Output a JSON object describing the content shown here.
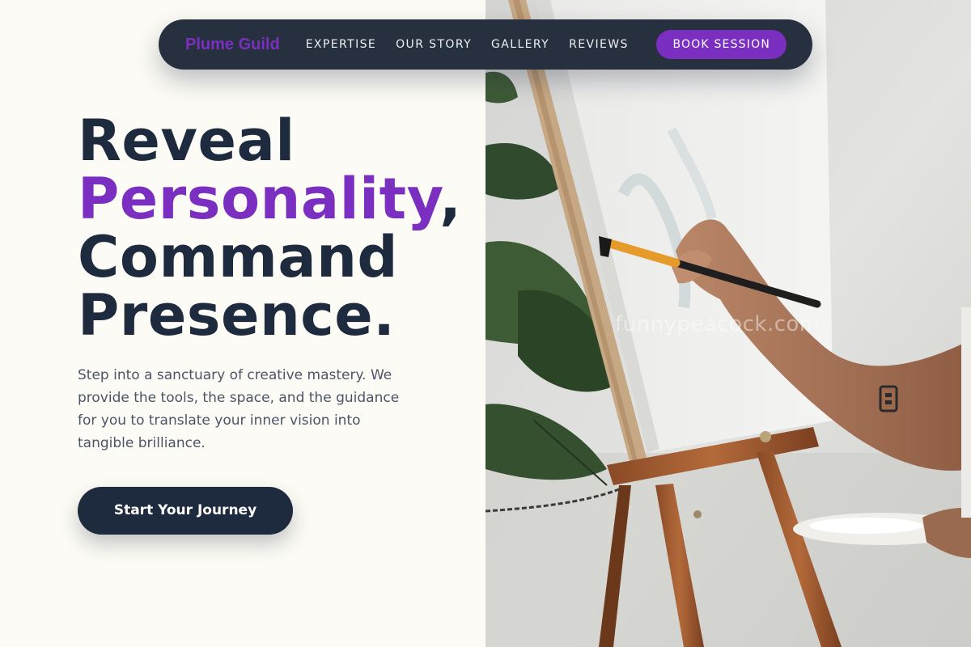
{
  "nav": {
    "brand": "Plume Guild",
    "links": [
      "EXPERTISE",
      "OUR STORY",
      "GALLERY",
      "REVIEWS"
    ],
    "cta": "BOOK SESSION"
  },
  "hero": {
    "title_line1": "Reveal",
    "title_accent": "Personality",
    "title_comma": ",",
    "title_line3": "Command",
    "title_line4": "Presence.",
    "description": "Step into a sanctuary of creative mastery. We provide the tools, the space, and the guidance for you to translate your inner vision into tangible brilliance.",
    "cta": "Start Your Journey"
  },
  "image": {
    "watermark": "funnypeacock.com",
    "subject": "artist painting on canvas at wooden easel"
  },
  "colors": {
    "accent": "#7b2fc0",
    "navy": "#1e2a3e",
    "nav_bg": "#26303f",
    "background": "#fcfbf5"
  }
}
